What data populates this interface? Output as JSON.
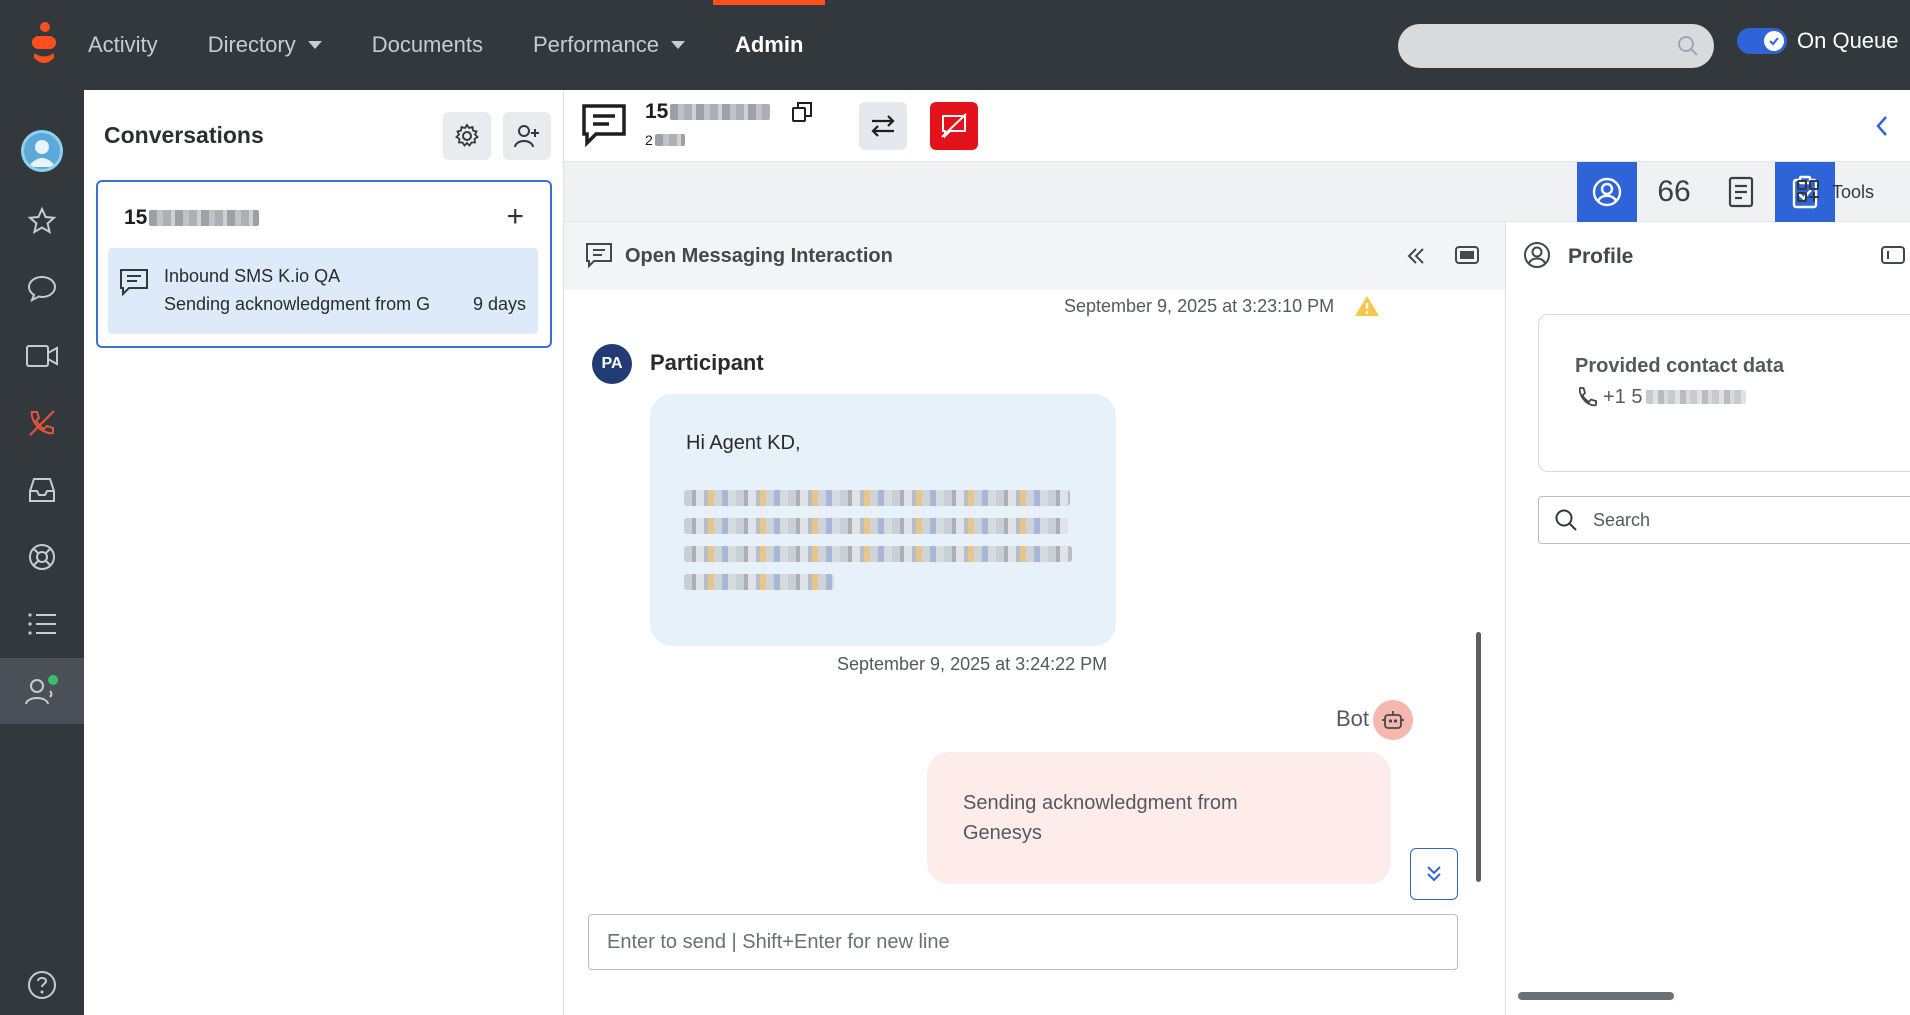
{
  "nav": {
    "items": [
      {
        "label": "Activity",
        "caret": false,
        "active": false
      },
      {
        "label": "Directory",
        "caret": true,
        "active": false
      },
      {
        "label": "Documents",
        "caret": false,
        "active": false
      },
      {
        "label": "Performance",
        "caret": true,
        "active": false
      },
      {
        "label": "Admin",
        "caret": false,
        "active": true
      }
    ],
    "queue_label": "On Queue",
    "queue_on": true
  },
  "colors": {
    "topbar": "#33383d",
    "accent_blue": "#2e64d8",
    "brand_orange": "#ff4f1f",
    "end_red": "#e3121b",
    "participant_bubble": "#e6f1f9",
    "bot_bubble": "#fdecea"
  },
  "rail": {
    "icons": [
      "avatar-icon",
      "star-icon",
      "chat-icon",
      "video-icon",
      "phone-off-icon",
      "inbox-icon",
      "lifebuoy-icon",
      "list-icon",
      "agent-status-icon",
      "help-icon"
    ]
  },
  "conversations": {
    "title": "Conversations",
    "card": {
      "number_prefix": "15",
      "item": {
        "name": "Inbound SMS K.io QA",
        "preview": "Sending acknowledgment from G",
        "age": "9 days"
      }
    }
  },
  "interaction": {
    "number_prefix": "15",
    "sub_prefix": "2",
    "tools_66": "66",
    "tools_label": "Tools"
  },
  "messaging": {
    "title": "Open Messaging Interaction",
    "timestamp_top": "September 9, 2025 at 3:23:10 PM",
    "participant": {
      "initials": "PA",
      "name": "Participant",
      "greeting": "Hi Agent KD,",
      "timestamp": "September 9, 2025 at 3:24:22 PM"
    },
    "bot": {
      "name": "Bot",
      "message": "Sending acknowledgment from Genesys"
    },
    "input_placeholder": "Enter to send | Shift+Enter for new line"
  },
  "profile": {
    "title": "Profile",
    "contact_title": "Provided contact data",
    "phone_prefix": "+1 5",
    "search_placeholder": "Search"
  }
}
